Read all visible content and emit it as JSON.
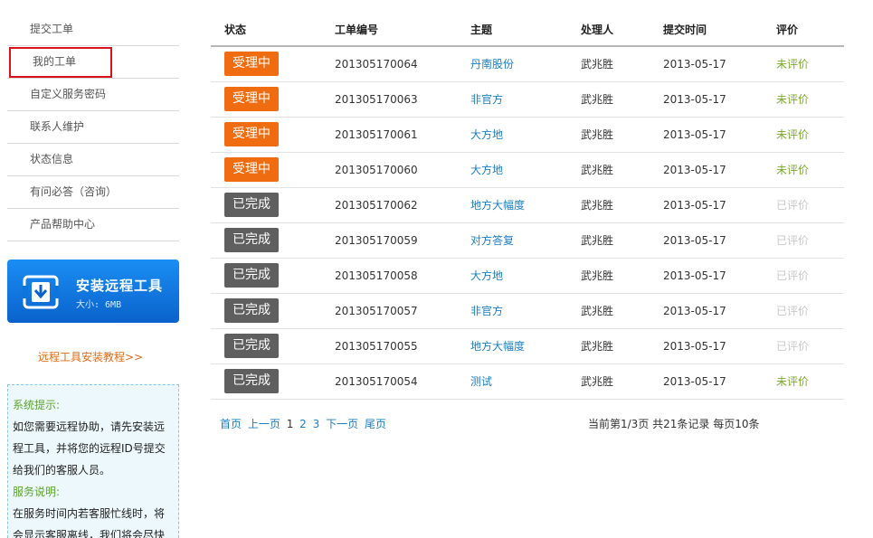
{
  "sidebar": {
    "items": [
      {
        "label": "提交工单"
      },
      {
        "label": "我的工单",
        "active": true
      },
      {
        "label": "自定义服务密码"
      },
      {
        "label": "联系人维护"
      },
      {
        "label": "状态信息"
      },
      {
        "label": "有问必答（咨询）"
      },
      {
        "label": "产品帮助中心"
      }
    ],
    "install": {
      "title": "安装远程工具",
      "size": "大小: 6MB",
      "icon": "download-icon"
    },
    "tutorial_link": "远程工具安装教程>>",
    "tips": {
      "heading1": "系统提示:",
      "text1_line1": "如您需要远程协助，请先安装远",
      "text1_line2": "程工具，并将您的远程ID号提交",
      "text1_line3": "给我们的客服人员。",
      "heading2": "服务说明:",
      "text2_line1": "在服务时间内若客服忙线时，将",
      "text2_line2": "会显示客服离线，我们将会尽快"
    }
  },
  "table": {
    "headers": {
      "status": "状态",
      "ticket_no": "工单编号",
      "subject": "主题",
      "handler": "处理人",
      "submit_time": "提交时间",
      "rating": "评价"
    },
    "rows": [
      {
        "status": "受理中",
        "status_type": "processing",
        "ticket_no": "201305170064",
        "subject": "丹南股份",
        "handler": "武兆胜",
        "submit_time": "2013-05-17",
        "rating": "未评价",
        "rating_type": "unrated"
      },
      {
        "status": "受理中",
        "status_type": "processing",
        "ticket_no": "201305170063",
        "subject": "非官方",
        "handler": "武兆胜",
        "submit_time": "2013-05-17",
        "rating": "未评价",
        "rating_type": "unrated"
      },
      {
        "status": "受理中",
        "status_type": "processing",
        "ticket_no": "201305170061",
        "subject": "大方地",
        "handler": "武兆胜",
        "submit_time": "2013-05-17",
        "rating": "未评价",
        "rating_type": "unrated"
      },
      {
        "status": "受理中",
        "status_type": "processing",
        "ticket_no": "201305170060",
        "subject": "大方地",
        "handler": "武兆胜",
        "submit_time": "2013-05-17",
        "rating": "未评价",
        "rating_type": "unrated"
      },
      {
        "status": "已完成",
        "status_type": "completed",
        "ticket_no": "201305170062",
        "subject": "地方大幅度",
        "handler": "武兆胜",
        "submit_time": "2013-05-17",
        "rating": "已评价",
        "rating_type": "rated"
      },
      {
        "status": "已完成",
        "status_type": "completed",
        "ticket_no": "201305170059",
        "subject": "对方答复",
        "handler": "武兆胜",
        "submit_time": "2013-05-17",
        "rating": "已评价",
        "rating_type": "rated"
      },
      {
        "status": "已完成",
        "status_type": "completed",
        "ticket_no": "201305170058",
        "subject": "大方地",
        "handler": "武兆胜",
        "submit_time": "2013-05-17",
        "rating": "已评价",
        "rating_type": "rated"
      },
      {
        "status": "已完成",
        "status_type": "completed",
        "ticket_no": "201305170057",
        "subject": "非官方",
        "handler": "武兆胜",
        "submit_time": "2013-05-17",
        "rating": "已评价",
        "rating_type": "rated"
      },
      {
        "status": "已完成",
        "status_type": "completed",
        "ticket_no": "201305170055",
        "subject": "地方大幅度",
        "handler": "武兆胜",
        "submit_time": "2013-05-17",
        "rating": "已评价",
        "rating_type": "rated"
      },
      {
        "status": "已完成",
        "status_type": "completed",
        "ticket_no": "201305170054",
        "subject": "测试",
        "handler": "武兆胜",
        "submit_time": "2013-05-17",
        "rating": "未评价",
        "rating_type": "unrated"
      }
    ]
  },
  "pager": {
    "first": "首页",
    "prev": "上一页",
    "pages": [
      "1",
      "2",
      "3"
    ],
    "current_page": "1",
    "next": "下一页",
    "last": "尾页",
    "info": "当前第1/3页 共21条记录 每页10条"
  },
  "colors": {
    "processing": "#ef6c10",
    "completed": "#5f5f5f",
    "link": "#1b7fc4",
    "unrated": "#7bab2a",
    "rated": "#c8c8c8",
    "active_outline": "#d9121c"
  }
}
